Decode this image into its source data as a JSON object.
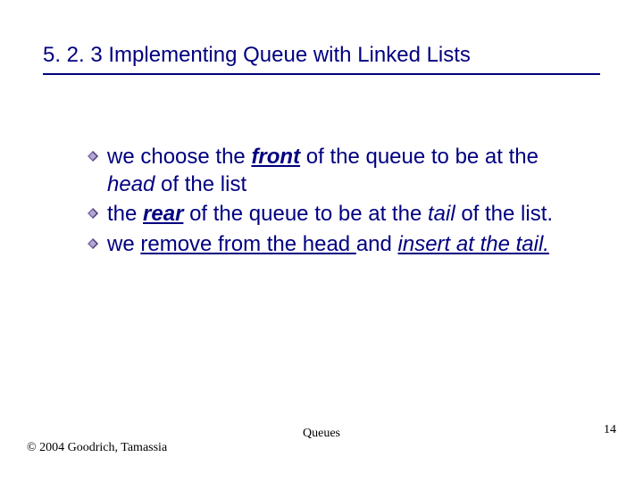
{
  "title": "5. 2. 3 Implementing Queue with Linked Lists",
  "bullets": [
    {
      "pre": "we choose the ",
      "strong": "front",
      "mid": " of the queue to be at the ",
      "ital": "head",
      "post": " of the list"
    },
    {
      "pre": "the ",
      "strong": "rear",
      "mid": " of the queue to be at the ",
      "ital": "tail",
      "post": " of the list."
    },
    {
      "pre": "we ",
      "under1": "remove from the head ",
      "mid": "and ",
      "under2": "insert at the tail."
    }
  ],
  "footer": {
    "left": "© 2004 Goodrich, Tamassia",
    "center": "Queues",
    "right": "14"
  }
}
